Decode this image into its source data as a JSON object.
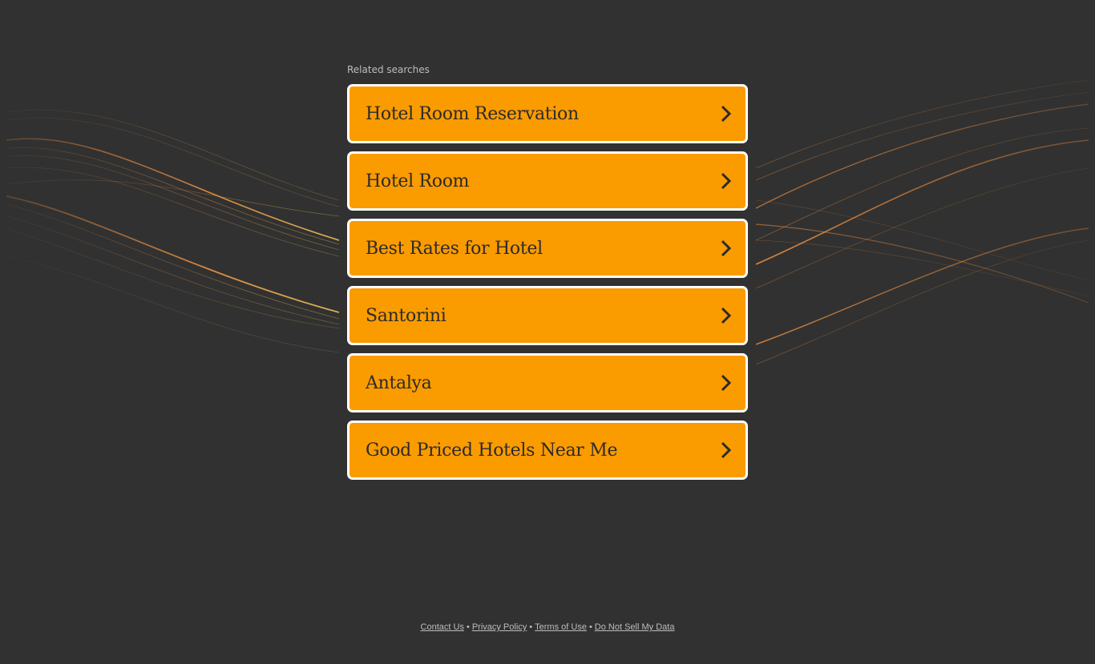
{
  "related_searches": {
    "title": "Related searches",
    "items": [
      {
        "label": "Hotel Room Reservation"
      },
      {
        "label": "Hotel Room"
      },
      {
        "label": "Best Rates for Hotel"
      },
      {
        "label": "Santorini"
      },
      {
        "label": "Antalya"
      },
      {
        "label": "Good Priced Hotels Near Me"
      }
    ]
  },
  "footer": {
    "links": [
      "Contact Us",
      "Privacy Policy",
      "Terms of Use",
      "Do Not Sell My Data"
    ],
    "separator": "•"
  },
  "colors": {
    "background": "#313131",
    "button": "#fa9b00",
    "button_border": "#ffffff",
    "wave": "#f08a3a"
  },
  "icons": {
    "item_arrow": "chevron-right-icon"
  }
}
